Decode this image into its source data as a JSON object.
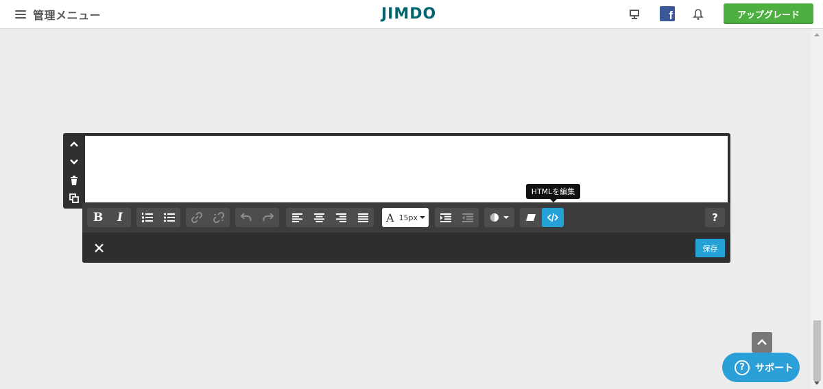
{
  "header": {
    "menu_label": "管理メニュー",
    "logo": "JIMDO",
    "facebook_letter": "f",
    "upgrade_label": "アップグレード"
  },
  "editor": {
    "font_size": "15px",
    "tooltip": "HTMLを編集",
    "save_label": "保存",
    "help_label": "?",
    "bold_label": "B",
    "italic_label": "I",
    "font_label": "A"
  },
  "support": {
    "label": "サポート",
    "icon_label": "?"
  },
  "colors": {
    "accent": "#24a2d8",
    "upgrade": "#4caf3f",
    "logo": "#00646f",
    "toolbar": "#3c3c3c",
    "frame": "#2e2e2e"
  },
  "icons": [
    "hamburger-icon",
    "desktop-icon",
    "facebook-icon",
    "bell-icon",
    "chevron-up-icon",
    "chevron-down-icon",
    "trash-icon",
    "copy-icon",
    "ordered-list-icon",
    "unordered-list-icon",
    "link-icon",
    "unlink-icon",
    "undo-icon",
    "redo-icon",
    "align-left-icon",
    "align-center-icon",
    "align-right-icon",
    "align-justify-icon",
    "indent-icon",
    "outdent-icon",
    "color-icon",
    "eraser-icon",
    "code-icon",
    "close-icon",
    "scroll-top-icon"
  ]
}
